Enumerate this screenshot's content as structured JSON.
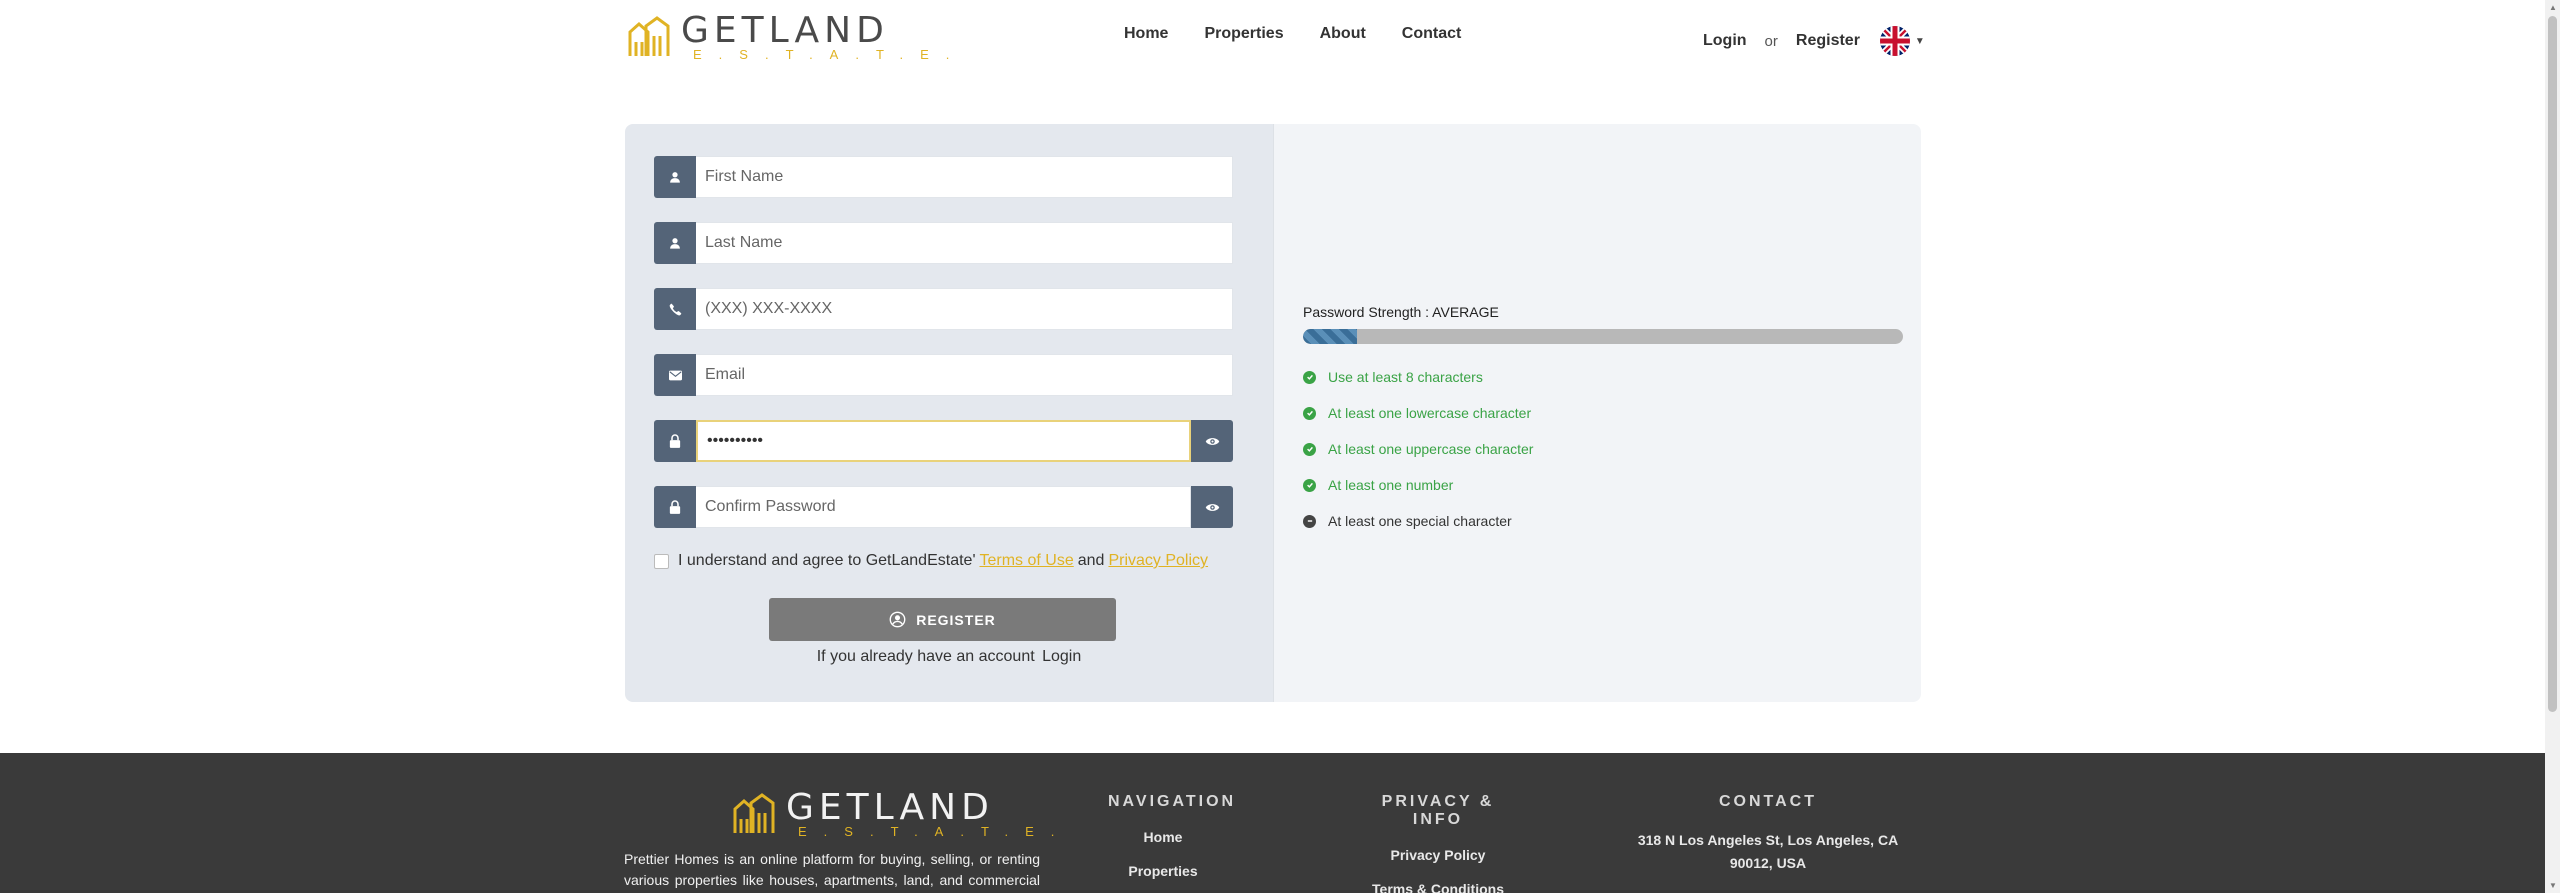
{
  "brand": {
    "name": "GETLAND",
    "tagline": "E.S.T.A.T.E."
  },
  "nav": [
    "Home",
    "Properties",
    "About",
    "Contact"
  ],
  "auth": {
    "login": "Login",
    "or": "or",
    "register": "Register",
    "language": "English"
  },
  "form": {
    "first_name_placeholder": "First Name",
    "last_name_placeholder": "Last Name",
    "phone_placeholder": "(XXX) XXX-XXXX",
    "email_placeholder": "Email",
    "password_value": "••••••••••",
    "confirm_placeholder": "Confirm Password",
    "agree_text": "I understand and agree to GetLandEstate'",
    "terms_link": "Terms of Use",
    "and": "and",
    "privacy_link": "Privacy Policy",
    "register_button": "REGISTER",
    "already_text": "If you already have an account",
    "login_link": "Login"
  },
  "strength": {
    "label": "Password Strength : AVERAGE",
    "progress": 0.09,
    "rules": [
      {
        "text": "Use at least 8 characters",
        "met": true
      },
      {
        "text": "At least one lowercase character",
        "met": true
      },
      {
        "text": "At least one uppercase character",
        "met": true
      },
      {
        "text": "At least one number",
        "met": true
      },
      {
        "text": "At least one special character",
        "met": false
      }
    ]
  },
  "footer": {
    "description": "Prettier Homes is an online platform for buying, selling, or renting various properties like houses, apartments, land, and commercial real estate. It",
    "navigation_title": "NAVIGATION",
    "navigation_items": [
      "Home",
      "Properties"
    ],
    "privacy_title": "PRIVACY & INFO",
    "privacy_items": [
      "Privacy Policy",
      "Terms & Conditions"
    ],
    "contact_title": "CONTACT",
    "address": "318 N Los Angeles St, Los Angeles, CA 90012, USA"
  },
  "colors": {
    "accent": "#e0b324",
    "icon_bg": "#546478",
    "success": "#3aa346",
    "footer_bg": "#3a3a3a"
  }
}
